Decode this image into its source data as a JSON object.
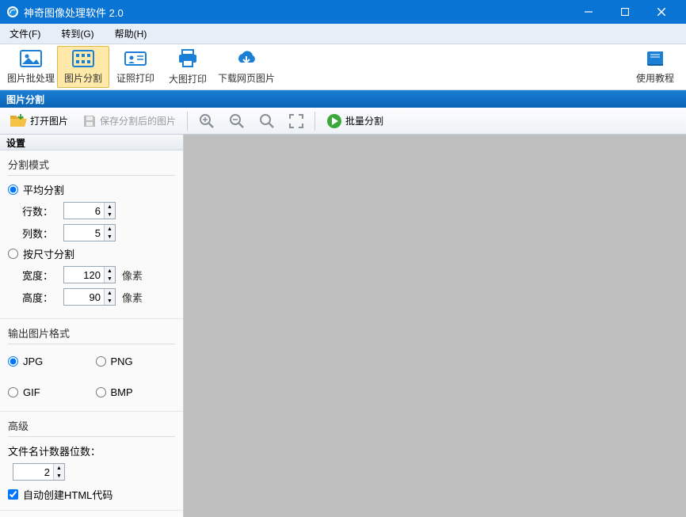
{
  "title": "神奇图像处理软件 2.0",
  "menu": {
    "file": "文件(F)",
    "goto": "转到(G)",
    "help": "帮助(H)"
  },
  "toolbar": {
    "batch": "图片批处理",
    "split": "图片分割",
    "idprint": "证照打印",
    "bigprint": "大图打印",
    "download": "下载网页图片",
    "tutorial": "使用教程"
  },
  "section_title": "图片分割",
  "toolrow": {
    "open": "打开图片",
    "save": "保存分割后的图片",
    "batch_split": "批量分割"
  },
  "settings_title": "设置",
  "split_mode": {
    "legend": "分割模式",
    "even": "平均分割",
    "rows_label": "行数：",
    "rows": "6",
    "cols_label": "列数：",
    "cols": "5",
    "by_size": "按尺寸分割",
    "width_label": "宽度：",
    "width": "120",
    "height_label": "高度：",
    "height": "90",
    "unit": "像素"
  },
  "format": {
    "legend": "输出图片格式",
    "jpg": "JPG",
    "png": "PNG",
    "gif": "GIF",
    "bmp": "BMP"
  },
  "advanced": {
    "legend": "高级",
    "counter_label": "文件名计数器位数：",
    "counter": "2",
    "auto_html": "自动创建HTML代码"
  }
}
